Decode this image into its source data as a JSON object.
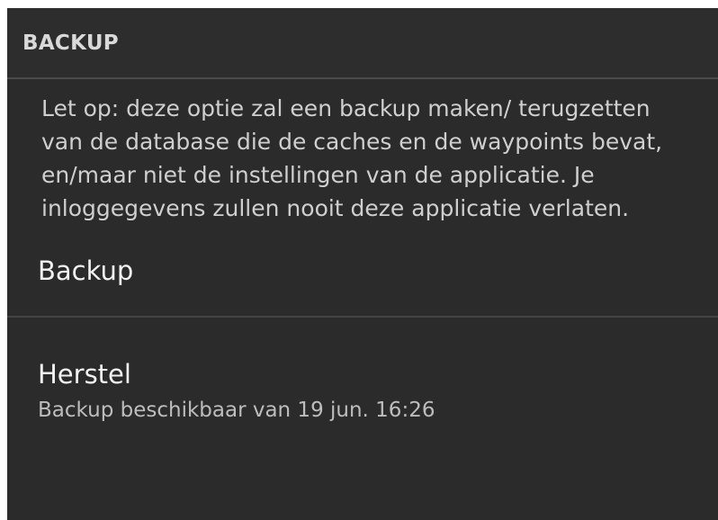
{
  "section": {
    "title": "BACKUP",
    "info": "Let op: deze optie zal een backup maken/ terugzetten van de database die de caches en de waypoints bevat, en/maar niet de instellingen van de applicatie. Je inloggegevens zullen nooit deze applicatie verlaten."
  },
  "items": [
    {
      "title": "Backup"
    },
    {
      "title": "Herstel",
      "summary": "Backup beschikbaar van 19 jun. 16:26"
    }
  ]
}
